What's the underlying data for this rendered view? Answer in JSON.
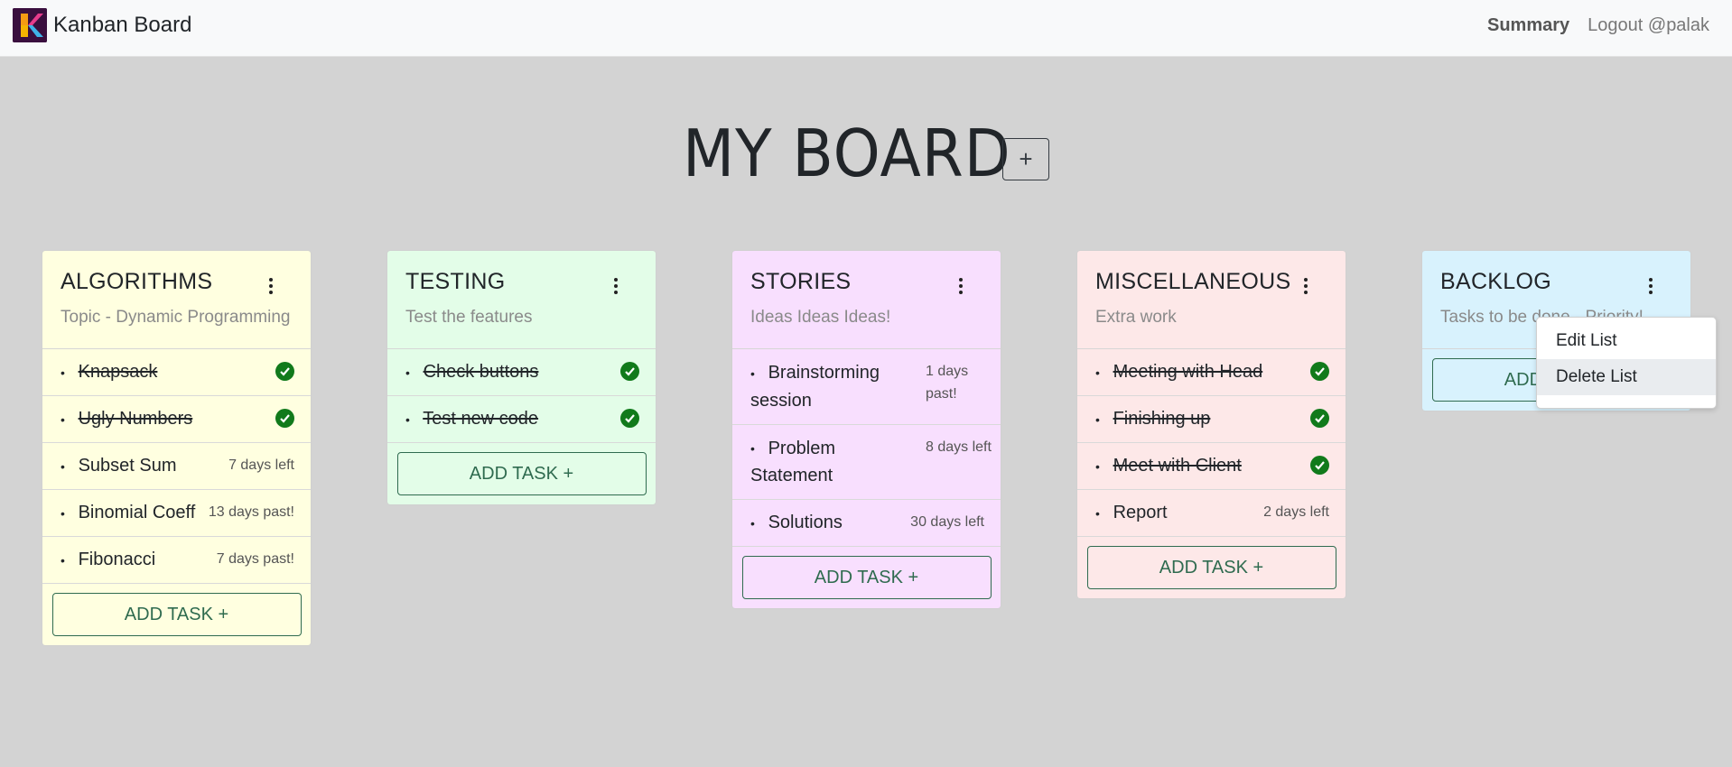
{
  "app": {
    "title": "Kanban Board"
  },
  "nav": {
    "summary": "Summary",
    "logout": "Logout @palak"
  },
  "board": {
    "title": "MY BOARD",
    "add_list_label": "+"
  },
  "add_task_label": "ADD TASK +",
  "colors": {
    "algorithms": "#ffffe0",
    "testing": "#e3fde8",
    "stories": "#f8dffe",
    "misc": "#fde8e8",
    "backlog": "#d8f2fd",
    "check": "#117a1b",
    "accent": "#2f6b4f"
  },
  "lists": [
    {
      "title": "ALGORITHMS",
      "subtitle": "Topic - Dynamic Programming",
      "tasks": [
        {
          "name": "Knapsack",
          "done": true,
          "due": ""
        },
        {
          "name": "Ugly Numbers",
          "done": true,
          "due": ""
        },
        {
          "name": "Subset Sum",
          "done": false,
          "due": "7 days left"
        },
        {
          "name": "Binomial Coeff",
          "done": false,
          "due": "13 days past!"
        },
        {
          "name": "Fibonacci",
          "done": false,
          "due": "7 days past!"
        }
      ]
    },
    {
      "title": "TESTING",
      "subtitle": "Test the features",
      "tasks": [
        {
          "name": "Check buttons",
          "done": true,
          "due": ""
        },
        {
          "name": "Test new code",
          "done": true,
          "due": ""
        }
      ]
    },
    {
      "title": "STORIES",
      "subtitle": "Ideas Ideas Ideas!",
      "tasks": [
        {
          "name": "Brainstorming session",
          "done": false,
          "due": "1 days past!"
        },
        {
          "name": "Problem Statement",
          "done": false,
          "due": "8 days left"
        },
        {
          "name": "Solutions",
          "done": false,
          "due": "30 days left"
        }
      ]
    },
    {
      "title": "MISCELLANEOUS",
      "subtitle": "Extra work",
      "tasks": [
        {
          "name": "Meeting with Head",
          "done": true,
          "due": ""
        },
        {
          "name": "Finishing up",
          "done": true,
          "due": ""
        },
        {
          "name": "Meet with Client",
          "done": true,
          "due": ""
        },
        {
          "name": "Report",
          "done": false,
          "due": "2 days left"
        }
      ]
    },
    {
      "title": "BACKLOG",
      "subtitle": "Tasks to be done - Priority!",
      "tasks": []
    }
  ],
  "dropdown": {
    "items": [
      "Edit List",
      "Delete List"
    ],
    "highlighted": "Delete List"
  }
}
